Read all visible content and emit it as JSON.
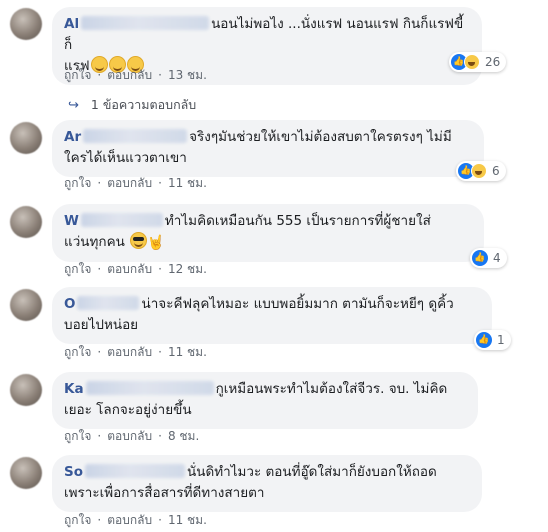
{
  "comments": [
    {
      "author": "Al",
      "text": "นอนไม่พอไง ...นั่งแรฟ นอนแรฟ กินก็แรฟขี้ก็แรฟ",
      "line1": "นอนไม่พอไง ...นั่งแรฟ นอนแรฟ กินก็แรฟขี้ก็",
      "line2": "แรฟ",
      "like": "ถูกใจ",
      "reply": "ตอบกลับ",
      "time": "13 ชม.",
      "reaction_count": "26",
      "reply_summary": "1 ข้อความตอบกลับ"
    },
    {
      "author": "Ar",
      "line1": "จริงๆมันช่วยให้เขาไม่ต้องสบตาใครตรงๆ ไม่มี",
      "line2": "ใครได้เห็นแววตาเขา",
      "like": "ถูกใจ",
      "reply": "ตอบกลับ",
      "time": "11 ชม.",
      "reaction_count": "6"
    },
    {
      "author": "W",
      "line1": "ทำไมคิดเหมือนกัน 555 เป็นรายการที่ผู้ชายใส่",
      "line2": "แว่นทุกคน",
      "like": "ถูกใจ",
      "reply": "ตอบกลับ",
      "time": "12 ชม.",
      "reaction_count": "4"
    },
    {
      "author": "O",
      "line1": "น่าจะคีฟลุคไหมอะ แบบพอยิ้มมาก ตามันก็จะหยีๆ ดูคิ้ว",
      "line2": "บอยไปหน่อย",
      "like": "ถูกใจ",
      "reply": "ตอบกลับ",
      "time": "11 ชม.",
      "reaction_count": "1"
    },
    {
      "author": "Ka",
      "line1": "กูเหมือนพระทำไมต้องใส่จีวร. จบ. ไม่คิด",
      "line2": "เยอะ โลกจะอยู่ง่ายขึ้น",
      "like": "ถูกใจ",
      "reply": "ตอบกลับ",
      "time": "8 ชม."
    },
    {
      "author": "So",
      "line1": "นั่นดิทำไมวะ ตอนที่อู๊ดใส่มาก็ยังบอกให้ถอด",
      "line2": "เพราะเพื่อการสื่อสารที่ดีทางสายตา",
      "like": "ถูกใจ",
      "reply": "ตอบกลับ",
      "time": "11 ชม."
    }
  ],
  "colors": {
    "author": "#385898",
    "bubble": "#f2f3f5",
    "meta": "#606770",
    "like_blue": "#1877f2"
  },
  "icons": {
    "like": "thumbs-up-icon",
    "haha": "laughing-face-icon",
    "reply_arrow": "reply-arrow-icon"
  }
}
